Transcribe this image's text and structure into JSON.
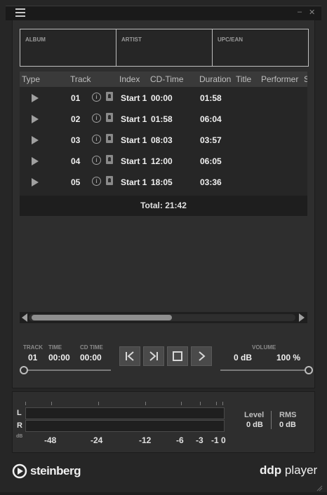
{
  "titlebar": {
    "menu_icon": "hamburger-icon",
    "minimize": "–",
    "close": "✕"
  },
  "info_fields": [
    {
      "label": "ALBUM"
    },
    {
      "label": "ARTIST"
    },
    {
      "label": "UPC/EAN"
    }
  ],
  "table": {
    "headers": [
      "Type",
      "Track",
      "Index",
      "CD-Time",
      "Duration",
      "Title",
      "Performer",
      "S"
    ],
    "rows": [
      {
        "track": "01",
        "index": "Start 1",
        "cd_time": "00:00",
        "duration": "01:58"
      },
      {
        "track": "02",
        "index": "Start 1",
        "cd_time": "01:58",
        "duration": "06:04"
      },
      {
        "track": "03",
        "index": "Start 1",
        "cd_time": "08:03",
        "duration": "03:57"
      },
      {
        "track": "04",
        "index": "Start 1",
        "cd_time": "12:00",
        "duration": "06:05"
      },
      {
        "track": "05",
        "index": "Start 1",
        "cd_time": "18:05",
        "duration": "03:36"
      }
    ],
    "info_glyph": "i",
    "total": "Total: 21:42"
  },
  "transport": {
    "track_label": "TRACK",
    "track_value": "01",
    "time_label": "TIME",
    "time_value": "00:00",
    "cd_time_label": "CD TIME",
    "cd_time_value": "00:00",
    "volume_label": "VOLUME",
    "volume_db": "0 dB",
    "volume_percent": "100 %",
    "volume_level": 1.0,
    "position_level": 0.0
  },
  "meter": {
    "left_label": "L",
    "right_label": "R",
    "db_label": "dB",
    "scale": [
      "-48",
      "-24",
      "-12",
      "-6",
      "-3",
      "-1",
      "0"
    ],
    "level_label": "Level",
    "level_value": "0 dB",
    "rms_label": "RMS",
    "rms_value": "0 dB"
  },
  "footer": {
    "brand": "steinberg",
    "product_bold": "ddp",
    "product_light": "player"
  },
  "colors": {
    "background": "#262626",
    "panel": "#2e2e2e",
    "text": "#e0e0e0",
    "accent_gray": "#8f8f8f"
  }
}
